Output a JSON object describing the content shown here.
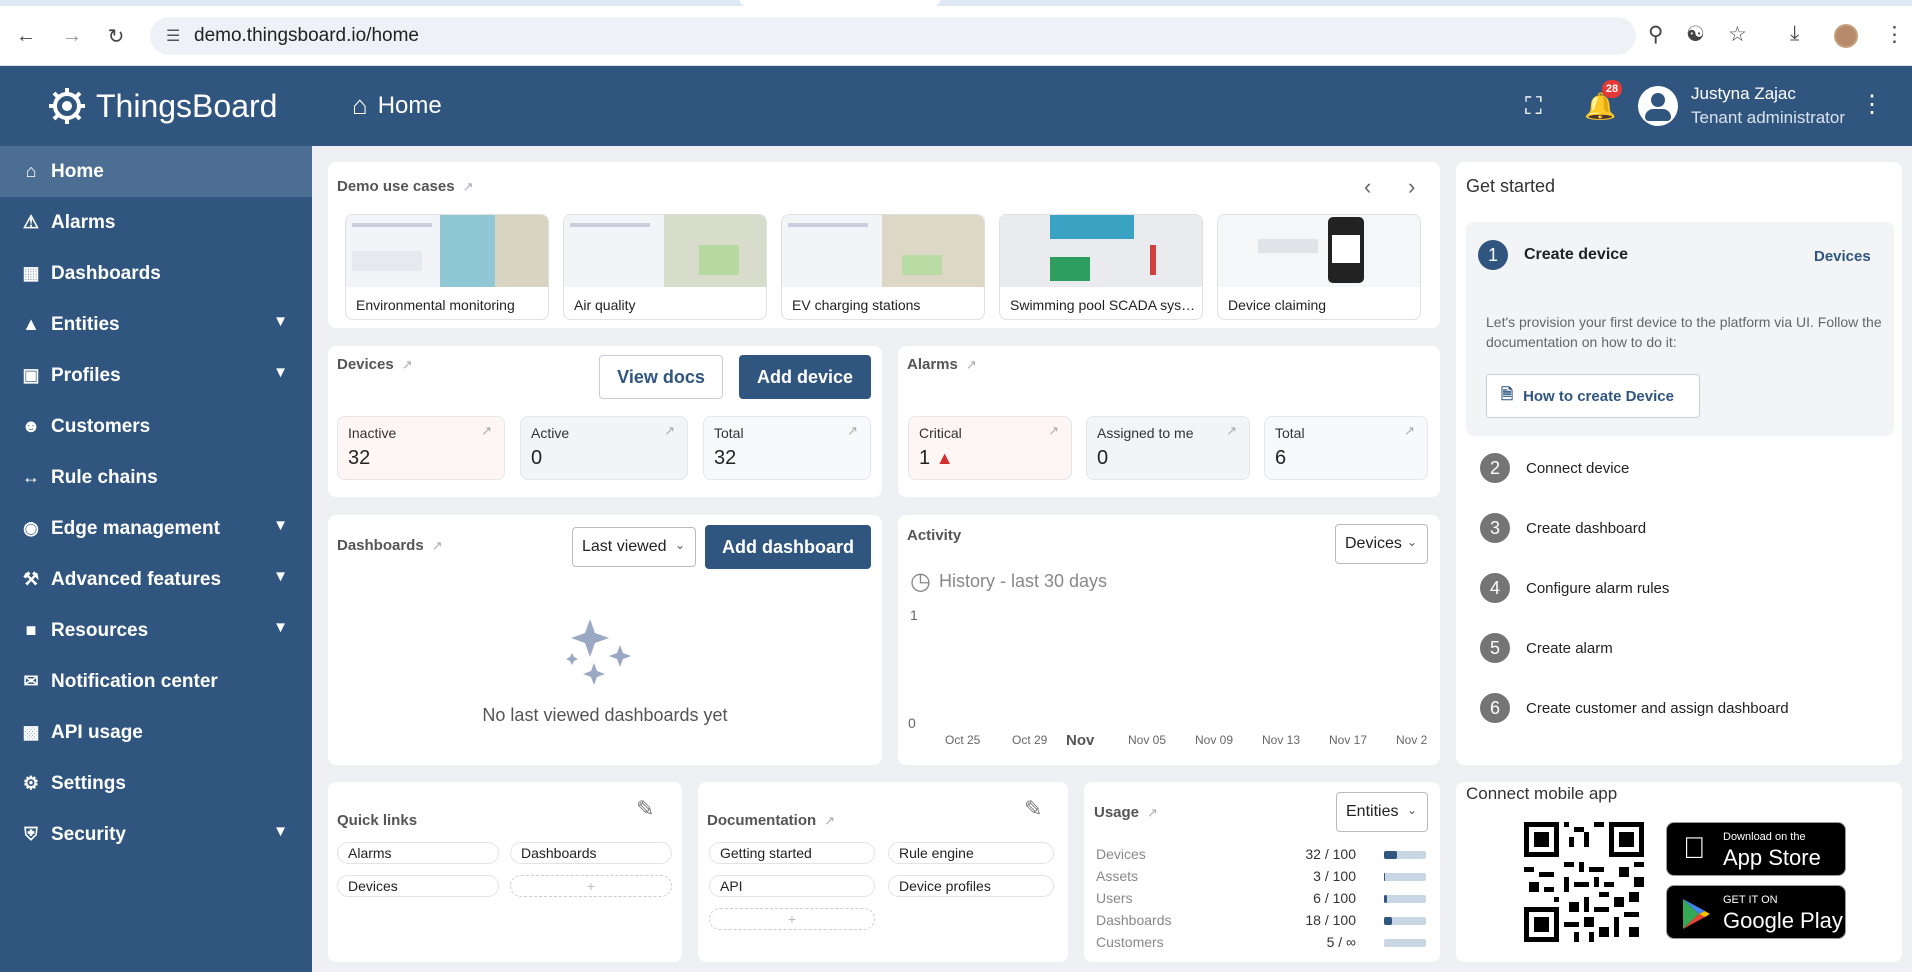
{
  "browser": {
    "url": "demo.thingsboard.io/home"
  },
  "app": {
    "brand": "ThingsBoard",
    "page_title": "Home",
    "notifications_count": "28"
  },
  "user": {
    "name": "Justyna Zajac",
    "role": "Tenant administrator"
  },
  "sidebar": {
    "items": [
      {
        "label": "Home",
        "icon": "home-icon"
      },
      {
        "label": "Alarms",
        "icon": "warning-icon"
      },
      {
        "label": "Dashboards",
        "icon": "dashboard-icon"
      },
      {
        "label": "Entities",
        "icon": "entities-icon"
      },
      {
        "label": "Profiles",
        "icon": "profiles-icon"
      },
      {
        "label": "Customers",
        "icon": "customers-icon"
      },
      {
        "label": "Rule chains",
        "icon": "rule-chains-icon"
      },
      {
        "label": "Edge management",
        "icon": "edge-icon"
      },
      {
        "label": "Advanced features",
        "icon": "tools-icon"
      },
      {
        "label": "Resources",
        "icon": "folder-icon"
      },
      {
        "label": "Notification center",
        "icon": "notification-icon"
      },
      {
        "label": "API usage",
        "icon": "chart-icon"
      },
      {
        "label": "Settings",
        "icon": "gear-icon"
      },
      {
        "label": "Security",
        "icon": "shield-icon"
      }
    ]
  },
  "demo": {
    "title": "Demo use cases",
    "cards": [
      "Environmental monitoring",
      "Air quality",
      "EV charging stations",
      "Swimming pool SCADA system",
      "Device claiming"
    ]
  },
  "devices": {
    "title": "Devices",
    "view_docs": "View docs",
    "add": "Add device",
    "stats": [
      {
        "label": "Inactive",
        "value": "32"
      },
      {
        "label": "Active",
        "value": "0"
      },
      {
        "label": "Total",
        "value": "32"
      }
    ]
  },
  "alarms": {
    "title": "Alarms",
    "stats": [
      {
        "label": "Critical",
        "value": "1"
      },
      {
        "label": "Assigned to me",
        "value": "0"
      },
      {
        "label": "Total",
        "value": "6"
      }
    ]
  },
  "dashboards": {
    "title": "Dashboards",
    "select": "Last viewed",
    "add": "Add dashboard",
    "empty": "No last viewed dashboards yet"
  },
  "activity": {
    "title": "Activity",
    "select": "Devices",
    "history": "History - last 30 days",
    "y_ticks": [
      "1",
      "0"
    ],
    "x_ticks": [
      "Oct 25",
      "Oct 29",
      "Nov",
      "Nov 05",
      "Nov 09",
      "Nov 13",
      "Nov 17",
      "Nov 2"
    ]
  },
  "get_started": {
    "title": "Get started",
    "link": "Devices",
    "desc": "Let's provision your first device to the platform via UI. Follow the documentation on how to do it:",
    "how_to": "How to create Device",
    "steps": [
      {
        "n": "1",
        "label": "Create device"
      },
      {
        "n": "2",
        "label": "Connect device"
      },
      {
        "n": "3",
        "label": "Create dashboard"
      },
      {
        "n": "4",
        "label": "Configure alarm rules"
      },
      {
        "n": "5",
        "label": "Create alarm"
      },
      {
        "n": "6",
        "label": "Create customer and assign dashboard"
      }
    ]
  },
  "quick_links": {
    "title": "Quick links",
    "items": [
      "Alarms",
      "Dashboards",
      "Devices"
    ]
  },
  "documentation": {
    "title": "Documentation",
    "items": [
      "Getting started",
      "Rule engine",
      "API",
      "Device profiles"
    ]
  },
  "usage": {
    "title": "Usage",
    "select": "Entities",
    "rows": [
      {
        "label": "Devices",
        "value": "32 / 100",
        "fill": 0.32
      },
      {
        "label": "Assets",
        "value": "3 / 100",
        "fill": 0.03
      },
      {
        "label": "Users",
        "value": "6 / 100",
        "fill": 0.06
      },
      {
        "label": "Dashboards",
        "value": "18 / 100",
        "fill": 0.18
      },
      {
        "label": "Customers",
        "value": "5 / ∞",
        "fill": 0
      }
    ]
  },
  "mobile": {
    "title": "Connect mobile app",
    "app_store_top": "Download on the",
    "app_store": "App Store",
    "play_top": "GET IT ON",
    "play": "Google Play"
  }
}
